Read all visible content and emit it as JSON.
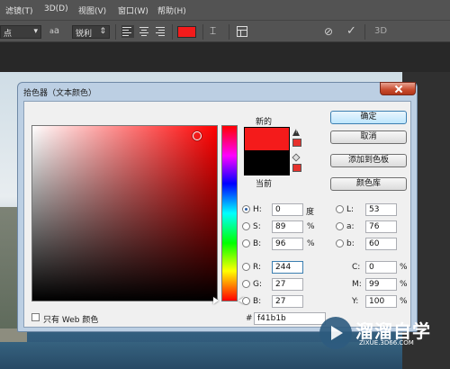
{
  "menubar": {
    "items": [
      "滤镜(T)",
      "3D(D)",
      "视图(V)",
      "窗口(W)",
      "帮助(H)"
    ]
  },
  "options_bar": {
    "font_size_partial": "点",
    "aa_label": "a",
    "aa_label2": "a",
    "antialias": "锐利",
    "text_color": "#f41b1b",
    "three_d": "3D"
  },
  "dialog": {
    "title": "拾色器（文本颜色）",
    "new_label": "新的",
    "current_label": "当前",
    "new_color": "#f41b1b",
    "current_color": "#000000",
    "buttons": {
      "ok": "确定",
      "cancel": "取消",
      "add_swatch": "添加到色板",
      "libraries": "颜色库"
    },
    "hsb": {
      "h_label": "H:",
      "h_value": "0",
      "h_unit": "度",
      "s_label": "S:",
      "s_value": "89",
      "s_unit": "%",
      "b_label": "B:",
      "b_value": "96",
      "b_unit": "%"
    },
    "rgb": {
      "r_label": "R:",
      "r_value": "244",
      "g_label": "G:",
      "g_value": "27",
      "b_label": "B:",
      "b_value": "27"
    },
    "lab": {
      "l_label": "L:",
      "l_value": "53",
      "a_label": "a:",
      "a_value": "76",
      "b_label": "b:",
      "b_value": "60"
    },
    "cmyk": {
      "c_label": "C:",
      "c_value": "0",
      "c_unit": "%",
      "m_label": "M:",
      "m_value": "99",
      "m_unit": "%",
      "y_label": "Y:",
      "y_value": "100",
      "y_unit": "%"
    },
    "hex_label": "#",
    "hex_value": "f41b1b",
    "web_only_label": "只有 Web 颜色"
  },
  "watermark": {
    "name": "溜溜自学",
    "url": "ZIXUE.3D66.COM"
  },
  "colors": {
    "ps_bg": "#535353",
    "dialog_frame": "#bccfe3",
    "accent_red": "#f41b1b"
  }
}
